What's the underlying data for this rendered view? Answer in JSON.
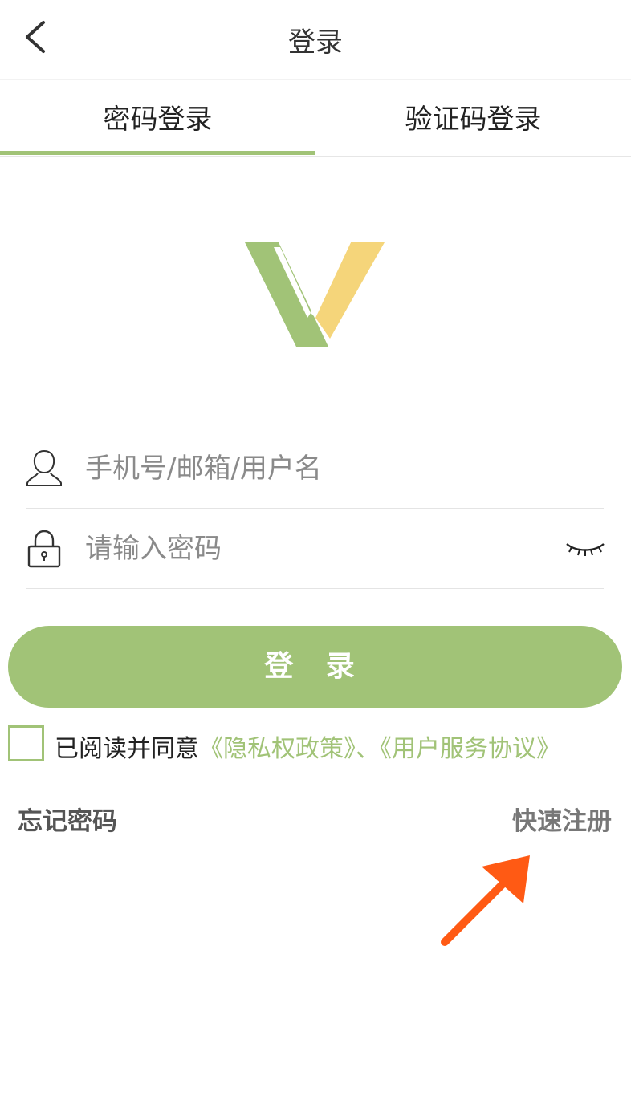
{
  "header": {
    "title": "登录",
    "back_icon": "chevron-left-icon"
  },
  "tabs": [
    {
      "label": "密码登录",
      "active": true
    },
    {
      "label": "验证码登录",
      "active": false
    }
  ],
  "form": {
    "username_placeholder": "手机号/邮箱/用户名",
    "password_placeholder": "请输入密码",
    "login_label": "登 录"
  },
  "agreement": {
    "prefix": "已阅读并同意",
    "privacy_link": "《隐私权政策》",
    "separator": "、",
    "terms_link": "《用户服务协议》",
    "checked": false
  },
  "links": {
    "forgot": "忘记密码",
    "register": "快速注册"
  },
  "colors": {
    "accent": "#a1c377",
    "logo_yellow": "#f5d57a",
    "annotation_arrow": "#ff5a14"
  }
}
